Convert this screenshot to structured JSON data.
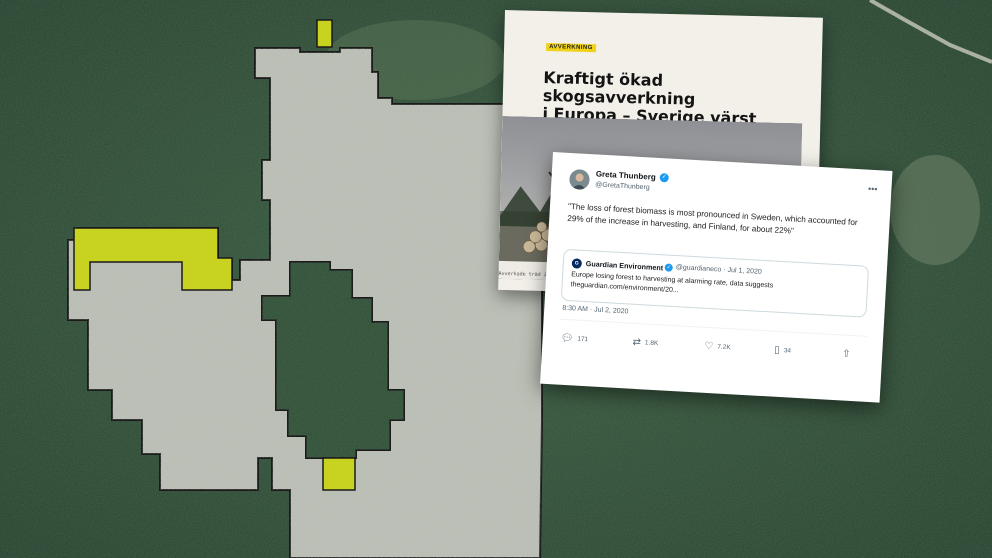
{
  "article": {
    "tag": "AVVERKNING",
    "headline_line1": "Kraftigt ökad skogsavverkning",
    "headline_line2": "i Europa – Sverige värst",
    "caption": "Avverkade träd i Sverige"
  },
  "tweet": {
    "author_name": "Greta Thunberg",
    "author_handle": "@GretaThunberg",
    "text": "\"The loss of forest biomass is most pronounced in Sweden, which accounted for 29% of the increase in harvesting, and Finland, for about 22%\"",
    "quote": {
      "author_name": "Guardian Environment",
      "author_handle": "@guardianeco",
      "date": "Jul 1, 2020",
      "text_line1": "Europe losing forest to harvesting at alarming rate, data suggests",
      "text_line2": "theguardian.com/environment/20..."
    },
    "timestamp": "8:30 AM · Jul 2, 2020",
    "replies": "171",
    "retweets": "1.8K",
    "likes": "7.2K",
    "bookmarks": "34"
  },
  "icons": {
    "verified": "verified-badge-icon",
    "more": "more-options-icon",
    "reply": "reply-icon",
    "retweet": "retweet-icon",
    "like": "heart-icon",
    "bookmark": "bookmark-icon",
    "share": "share-icon"
  },
  "colors": {
    "forest": "#2f4a34",
    "clearcut": "#b9bdb4",
    "highlight": "#c8d321",
    "tag_yellow": "#f1d21a",
    "twitter_blue": "#1d9bf0"
  }
}
